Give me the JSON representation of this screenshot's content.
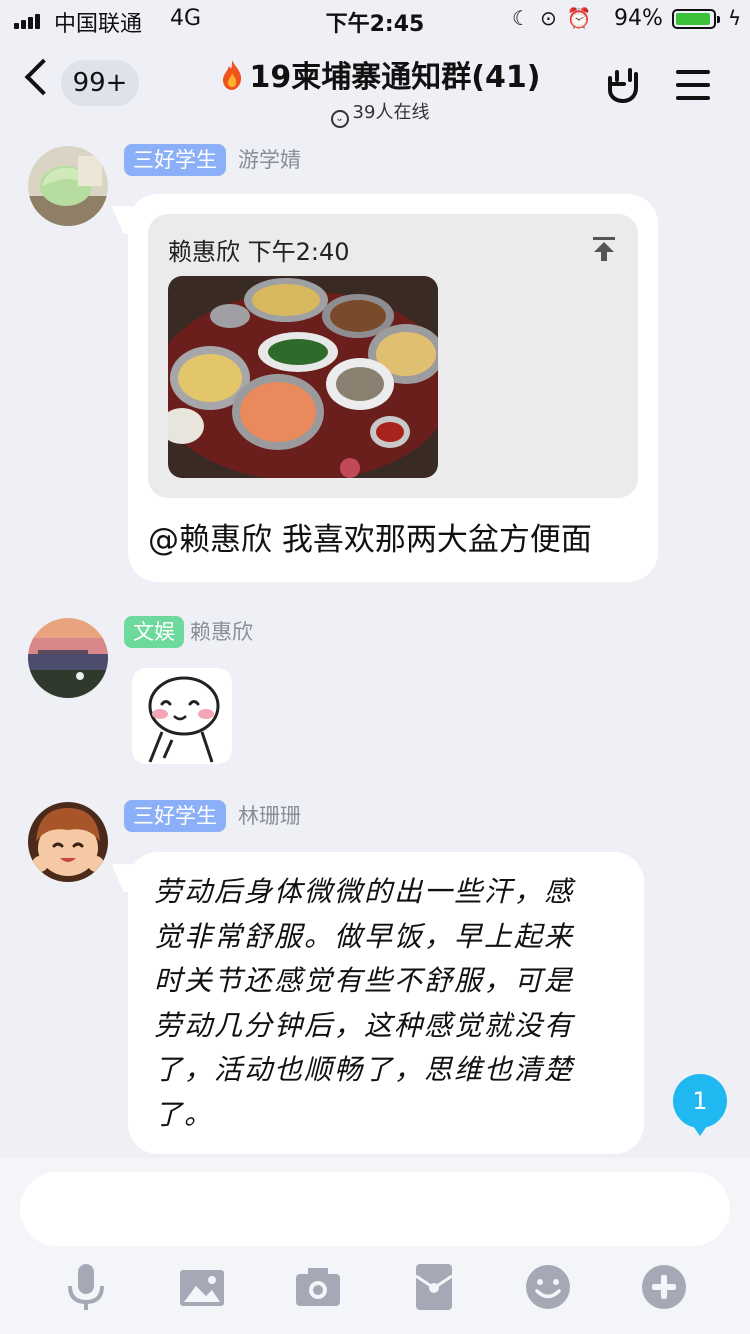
{
  "status_bar": {
    "carrier": "中国联通",
    "network": "4G",
    "time": "下午2:45",
    "battery_percent": "94%",
    "battery_level": 0.94,
    "icons": [
      "moon-icon",
      "rotation-lock-icon",
      "alarm-icon",
      "charging-icon"
    ]
  },
  "nav": {
    "back_badge": "99+",
    "title": "19柬埔寨通知群(41)",
    "online": "39人在线",
    "right_icons": [
      "hand-gesture-icon",
      "menu-icon"
    ]
  },
  "messages": [
    {
      "tag": "三好学生",
      "tag_color": "#8bb0f7",
      "sender": "游学婧",
      "quote": {
        "author": "赖惠欣",
        "time": "下午2:40"
      },
      "text": "@赖惠欣 我喜欢那两大盆方便面"
    },
    {
      "tag": "文娱",
      "tag_color": "#6dd99c",
      "sender": "赖惠欣",
      "sticker": "smiling-face-sticker"
    },
    {
      "tag": "三好学生",
      "tag_color": "#8bb0f7",
      "sender": "林珊珊",
      "lines": [
        "劳动后身体微微的出一些汗，感",
        "觉非常舒服。做早饭，早上起来",
        "时关节还感觉有些不舒服，可是",
        "劳动几分钟后，这种感觉就没有",
        "了，活动也顺畅了，思维也清楚",
        "了。"
      ]
    }
  ],
  "new_badge": "1",
  "input": {
    "placeholder": ""
  },
  "toolbar": [
    "microphone-icon",
    "image-icon",
    "camera-icon",
    "red-packet-icon",
    "emoji-icon",
    "plus-icon"
  ]
}
